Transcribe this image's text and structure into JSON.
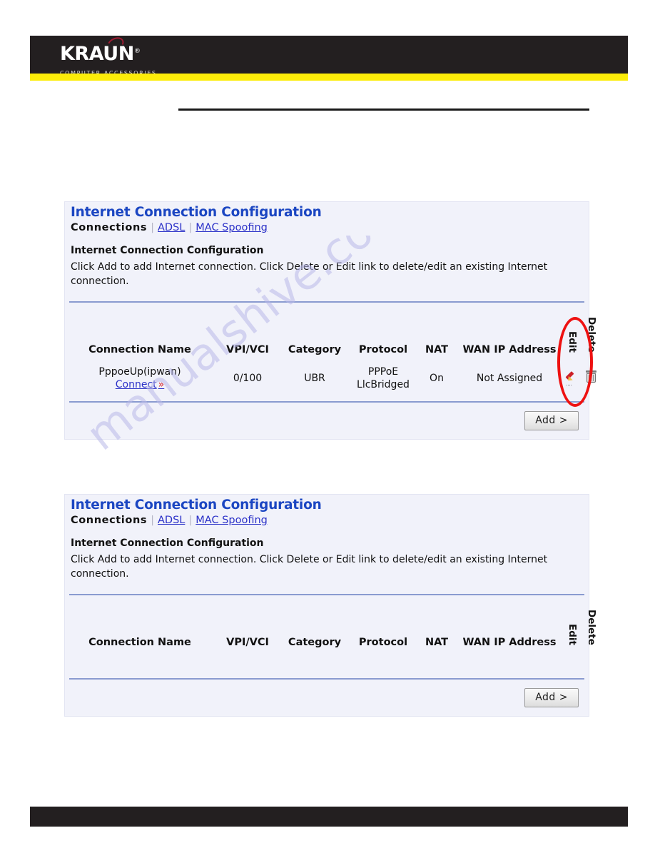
{
  "brand": {
    "wordmark": "KRAUN",
    "registered": "®",
    "tagline": "COMPUTER ACCESSORIES"
  },
  "watermark": {
    "text": "manualshive.com"
  },
  "panels": [
    {
      "title": "Internet Connection Configuration",
      "nav": {
        "current": "Connections",
        "sep1": "|",
        "link1": "ADSL",
        "sep2": "|",
        "link2": "MAC Spoofing"
      },
      "section_heading": "Internet Connection Configuration",
      "section_description": "Click Add to add Internet connection. Click Delete or Edit link to delete/edit an existing Internet connection.",
      "table": {
        "columns": [
          "Connection Name",
          "VPI/VCI",
          "Category",
          "Protocol",
          "NAT",
          "WAN IP Address",
          "Edit",
          "Delete"
        ],
        "rows": [
          {
            "name": "PppoeUp(ipwan)",
            "connect_label": "Connect",
            "connect_chevron": "»",
            "vpi_vci": "0/100",
            "category": "UBR",
            "protocol_line1": "PPPoE",
            "protocol_line2": "LlcBridged",
            "nat": "On",
            "wan_ip": "Not Assigned",
            "edit_icon": "pencil-icon",
            "delete_icon": "trash-icon"
          }
        ]
      },
      "add_button": "Add >"
    },
    {
      "title": "Internet Connection Configuration",
      "nav": {
        "current": "Connections",
        "sep1": "|",
        "link1": "ADSL",
        "sep2": "|",
        "link2": "MAC Spoofing"
      },
      "section_heading": "Internet Connection Configuration",
      "section_description": "Click Add to add Internet connection. Click Delete or Edit link to delete/edit an existing Internet connection.",
      "table": {
        "columns": [
          "Connection Name",
          "VPI/VCI",
          "Category",
          "Protocol",
          "NAT",
          "WAN IP Address",
          "Edit",
          "Delete"
        ],
        "rows": []
      },
      "add_button": "Add >"
    }
  ],
  "annotation": {
    "shape": "red-ellipse",
    "target": "delete-column"
  },
  "colors": {
    "brand_dark": "#231f20",
    "brand_yellow": "#fced09",
    "title_blue": "#1b46c2",
    "link_blue": "#2b31c8",
    "panel_bg": "#f1f2fa",
    "divider_blue": "#8a9bd0",
    "annotation_red": "#ee1111"
  }
}
